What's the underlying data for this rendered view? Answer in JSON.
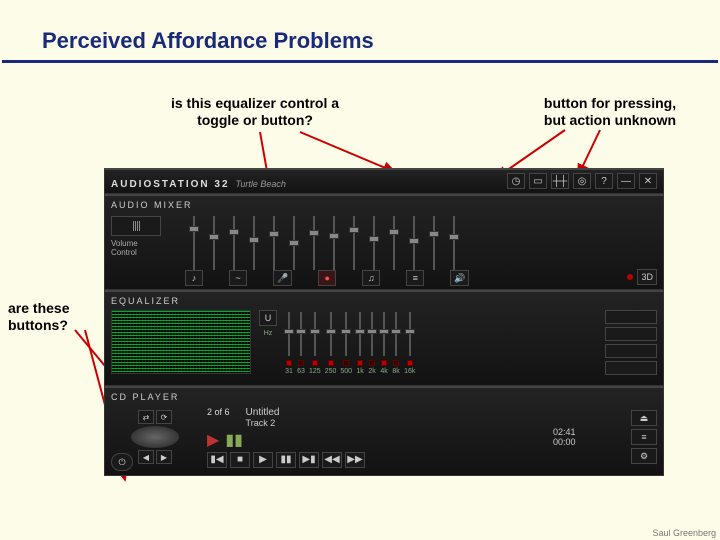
{
  "slide": {
    "title": "Perceived Affordance Problems",
    "credit": "Saul Greenberg",
    "annotations": {
      "equalizer_question": "is this equalizer control a\ntoggle or button?",
      "button_unknown": "button for pressing,\nbut action unknown",
      "are_these_buttons": "are these\nbuttons?"
    }
  },
  "app": {
    "brand": {
      "name": "AUDIOSTATION 32",
      "sub": "Turtle Beach"
    },
    "titlebar": {
      "icons": [
        "clock-icon",
        "folder-icon",
        "graph-icon",
        "globe-icon",
        "help-icon",
        "minimize-icon",
        "close-icon"
      ]
    },
    "mixer": {
      "title": "AUDIO MIXER",
      "volume_label": "Volume\nControl",
      "right_label_3d": "3D",
      "bottom_icons": [
        "music-note-icon",
        "wave-icon",
        "mic-icon",
        "note2-icon",
        "synth-icon",
        "line-icon",
        "speaker-icon"
      ]
    },
    "equalizer": {
      "title": "EQUALIZER",
      "bands": [
        "31",
        "63",
        "125",
        "250",
        "500",
        "1k",
        "2k",
        "4k",
        "8k",
        "16k"
      ],
      "hz_label": "Hz",
      "u_label": "U"
    },
    "cd": {
      "title": "CD PLAYER",
      "counter": "2 of 6",
      "track_title": "Untitled",
      "track_sub": "Track 2",
      "time_elapsed": "02:41",
      "time_total": "00:00"
    }
  }
}
